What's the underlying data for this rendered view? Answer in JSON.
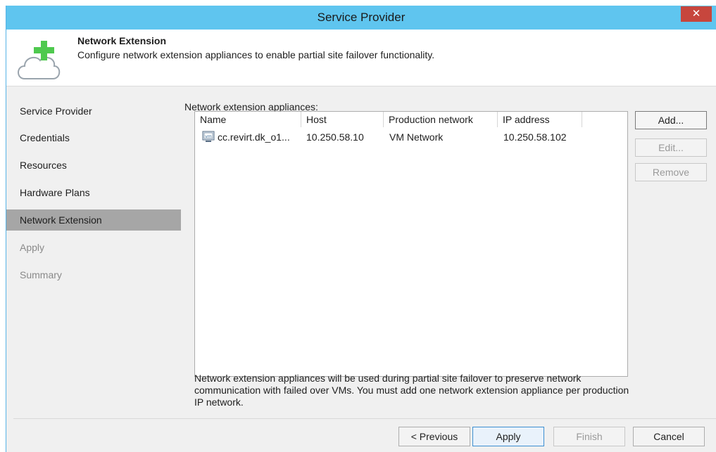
{
  "window": {
    "title": "Service Provider",
    "close_glyph": "✕"
  },
  "header": {
    "title": "Network Extension",
    "description": "Configure network extension appliances to enable partial site failover functionality.",
    "icon": "cloud-plus-icon",
    "accent": "#4ec94e"
  },
  "nav": {
    "items": [
      {
        "label": "Service Provider",
        "state": "normal"
      },
      {
        "label": "Credentials",
        "state": "normal"
      },
      {
        "label": "Resources",
        "state": "normal"
      },
      {
        "label": "Hardware Plans",
        "state": "normal"
      },
      {
        "label": "Network Extension",
        "state": "active"
      },
      {
        "label": "Apply",
        "state": "disabled"
      },
      {
        "label": "Summary",
        "state": "disabled"
      }
    ]
  },
  "content": {
    "list_label": "Network extension appliances:",
    "columns": [
      "Name",
      "Host",
      "Production network",
      "IP address"
    ],
    "rows": [
      {
        "name": "cc.revirt.dk_o1...",
        "host": "10.250.58.10",
        "network": "VM Network",
        "ip": "10.250.58.102",
        "icon": "vm-icon"
      }
    ],
    "side_buttons": {
      "add": "Add...",
      "edit": "Edit...",
      "remove": "Remove"
    },
    "note": "Network extension appliances will be used during partial site failover to preserve network communication with failed over VMs. You must add one network extension appliance per production IP network."
  },
  "footer": {
    "previous": "< Previous",
    "apply": "Apply",
    "finish": "Finish",
    "cancel": "Cancel"
  }
}
